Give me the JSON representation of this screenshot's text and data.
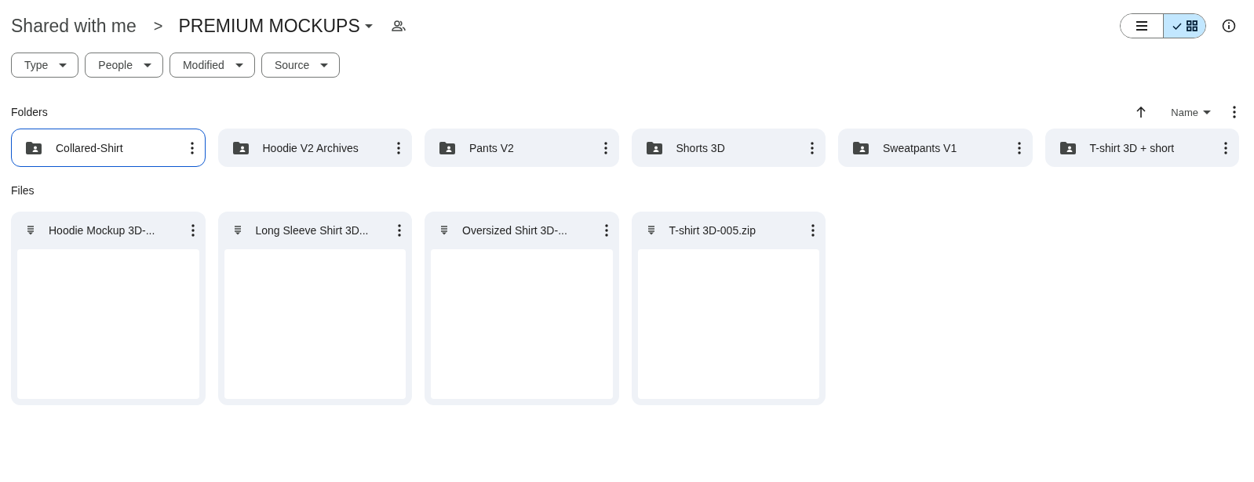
{
  "breadcrumb": {
    "parent": "Shared with me",
    "separator": ">",
    "current": "PREMIUM MOCKUPS"
  },
  "view_toggle": [
    {
      "kind": "list",
      "selected": false
    },
    {
      "kind": "grid",
      "selected": true
    }
  ],
  "filters": [
    {
      "label": "Type"
    },
    {
      "label": "People"
    },
    {
      "label": "Modified"
    },
    {
      "label": "Source"
    }
  ],
  "folders_section": {
    "title": "Folders",
    "sort_label": "Name"
  },
  "folders": [
    {
      "name": "Collared-Shirt",
      "selected": true
    },
    {
      "name": "Hoodie V2 Archives",
      "selected": false
    },
    {
      "name": "Pants V2",
      "selected": false
    },
    {
      "name": "Shorts 3D",
      "selected": false
    },
    {
      "name": "Sweatpants V1",
      "selected": false
    },
    {
      "name": "T-shirt 3D + short",
      "selected": false
    }
  ],
  "files_section": {
    "title": "Files"
  },
  "files": [
    {
      "name": "Hoodie Mockup 3D-..."
    },
    {
      "name": "Long Sleeve Shirt 3D..."
    },
    {
      "name": "Oversized Shirt 3D-..."
    },
    {
      "name": "T-shirt 3D-005.zip"
    }
  ]
}
